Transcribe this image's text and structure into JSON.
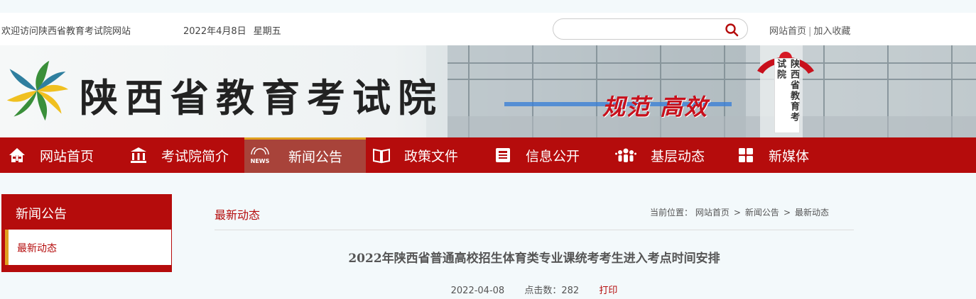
{
  "topbar": {
    "welcome": "欢迎访问陕西省教育考试院网站",
    "date": "2022年4月8日",
    "weekday": "星期五",
    "search_placeholder": "",
    "links": [
      "网站首页",
      "加入收藏"
    ],
    "link_separator": "|"
  },
  "banner": {
    "site_name": "陕西省教育考试院",
    "slogan": "规范 高效",
    "plaque_text": "陕西省教育考试院"
  },
  "nav": {
    "items": [
      {
        "label": "网站首页",
        "icon": "home-icon"
      },
      {
        "label": "考试院简介",
        "icon": "building-icon"
      },
      {
        "label": "新闻公告",
        "icon": "news-icon",
        "active": true
      },
      {
        "label": "政策文件",
        "icon": "book-icon"
      },
      {
        "label": "信息公开",
        "icon": "document-icon"
      },
      {
        "label": "基层动态",
        "icon": "people-icon"
      },
      {
        "label": "新媒体",
        "icon": "grid-icon"
      }
    ],
    "news_icon_text": "NEWS"
  },
  "sidebar": {
    "title": "新闻公告",
    "items": [
      {
        "label": "最新动态"
      }
    ]
  },
  "main": {
    "section_title": "最新动态",
    "breadcrumb": {
      "prefix": "当前位置：",
      "items": [
        "网站首页",
        "新闻公告",
        "最新动态"
      ],
      "separator": ">"
    },
    "article": {
      "title": "2022年陕西省普通高校招生体育类专业课统考考生进入考点时间安排",
      "date": "2022-04-08",
      "views_label": "点击数：",
      "views": "282",
      "print_label": "打印"
    }
  },
  "colors": {
    "primary_red": "#b50c0c",
    "active_nav": "#a8433a",
    "accent_gold": "#e0a020"
  }
}
